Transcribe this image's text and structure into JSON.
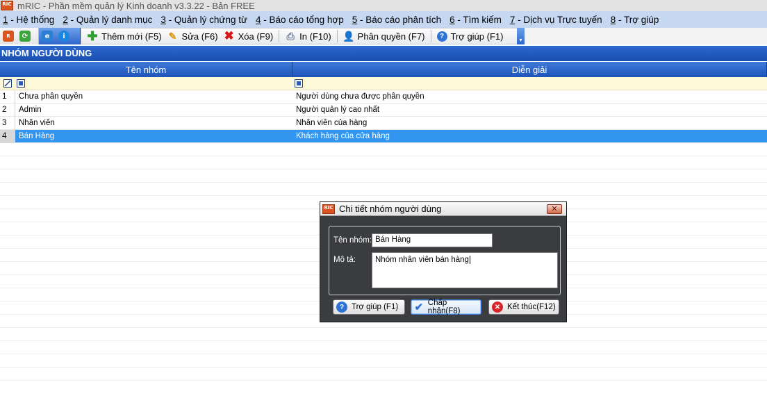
{
  "window": {
    "title": "mRIC - Phần mềm quản lý Kinh doanh v3.3.22 - Bản FREE",
    "logo_text": "RIC"
  },
  "menu": [
    {
      "key": "1",
      "label": " - Hệ thống"
    },
    {
      "key": "2",
      "label": " - Quản lý danh mục"
    },
    {
      "key": "3",
      "label": " - Quản lý chứng từ"
    },
    {
      "key": "4",
      "label": " - Báo cáo tổng hợp"
    },
    {
      "key": "5",
      "label": " - Báo cáo phân tích"
    },
    {
      "key": "6",
      "label": " - Tìm kiếm"
    },
    {
      "key": "7",
      "label": " - Dịch vụ Trực tuyến"
    },
    {
      "key": "8",
      "label": " - Trợ giúp"
    }
  ],
  "toolbar": {
    "add": "Thêm mới (F5)",
    "edit": "Sửa (F6)",
    "delete": "Xóa (F9)",
    "print": "In (F10)",
    "permission": "Phân quyền (F7)",
    "help": "Trợ giúp (F1)"
  },
  "section": {
    "title": "NHÓM NGƯỜI DÙNG"
  },
  "grid": {
    "columns": {
      "name": "Tên nhóm",
      "desc": "Diễn giải"
    },
    "rows": [
      {
        "num": "1",
        "name": "Chưa phân quyền",
        "desc": "Người dùng chưa được phân quyền"
      },
      {
        "num": "2",
        "name": "Admin",
        "desc": "Người quản lý cao nhất"
      },
      {
        "num": "3",
        "name": "Nhân viên",
        "desc": "Nhân viên của hàng"
      },
      {
        "num": "4",
        "name": "Bán Hàng",
        "desc": "Khách hàng của cửa hàng"
      }
    ]
  },
  "dialog": {
    "title": "Chi tiết nhóm người dùng",
    "name_label": "Tên nhóm:",
    "name_value": "Bán Hàng",
    "desc_label": "Mô tả:",
    "desc_value": "Nhóm nhân viên bán hàng",
    "help_button": "Trợ giúp (F1)",
    "accept_button": "Chấp nhận(F8)",
    "close_button": "Kết thúc(F12)"
  },
  "colors": {
    "accent": "#1a4fb0",
    "selected_row": "#3296f0",
    "filter_row": "#fdf9d8",
    "menu_bg": "#c6d7f1"
  }
}
